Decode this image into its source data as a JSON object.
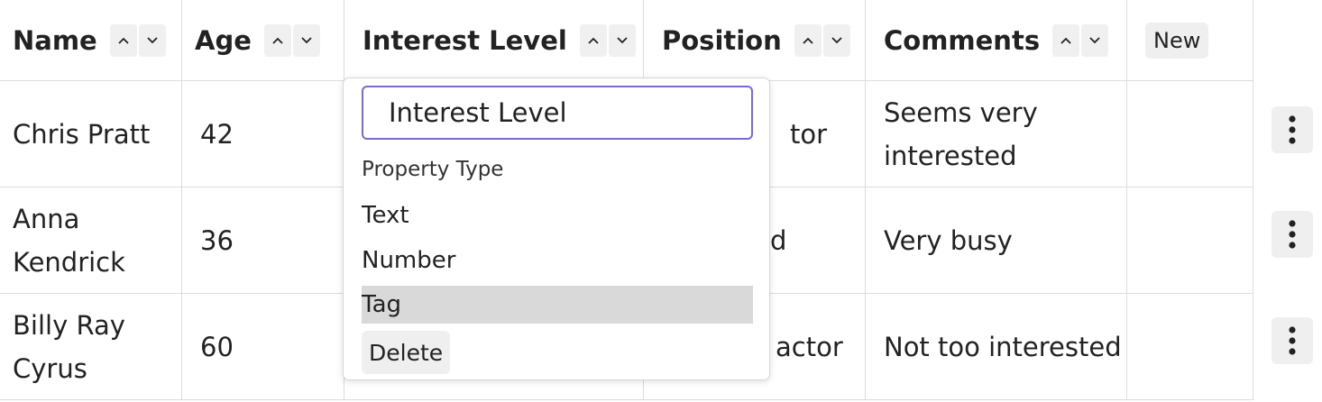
{
  "table": {
    "headers": [
      {
        "label": "Name"
      },
      {
        "label": "Age"
      },
      {
        "label": "Interest Level"
      },
      {
        "label": "Position"
      },
      {
        "label": "Comments"
      }
    ],
    "new_label": "New",
    "rows": [
      {
        "name": "Chris Pratt",
        "age": "42",
        "position": "tor",
        "comments": "Seems very interested"
      },
      {
        "name": "Anna Kendrick",
        "age": "36",
        "position": "d",
        "comments": "Very busy"
      },
      {
        "name": "Billy Ray Cyrus",
        "age": "60",
        "position": "actor",
        "comments": "Not too interested"
      }
    ]
  },
  "popover": {
    "name_value": "Interest Level",
    "section_label": "Property Type",
    "types": [
      "Text",
      "Number",
      "Tag"
    ],
    "selected_type": "Tag",
    "delete_label": "Delete"
  },
  "icons": {
    "sort_up": "chevron-up-icon",
    "sort_down": "chevron-down-icon",
    "row_menu": "more-vertical-icon"
  }
}
